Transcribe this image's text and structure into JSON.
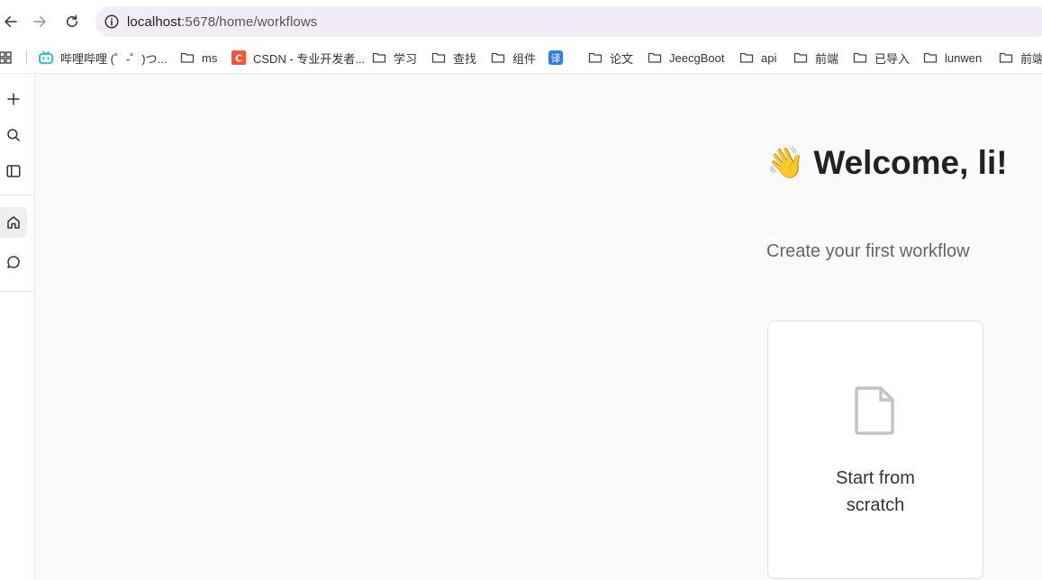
{
  "browser": {
    "url_host": "localhost",
    "url_rest": ":5678/home/workflows"
  },
  "bookmarks": [
    {
      "label": "哔哩哔哩 (゜-゜)つ...",
      "icon": "bilibili-icon"
    },
    {
      "label": "ms",
      "icon": "folder-icon"
    },
    {
      "label": "CSDN - 专业开发者...",
      "icon": "csdn-icon"
    },
    {
      "label": "学习",
      "icon": "folder-icon"
    },
    {
      "label": "查找",
      "icon": "folder-icon"
    },
    {
      "label": "组件",
      "icon": "folder-icon"
    },
    {
      "label": "",
      "icon": "translate-icon"
    },
    {
      "label": "论文",
      "icon": "folder-icon"
    },
    {
      "label": "JeecgBoot",
      "icon": "folder-icon"
    },
    {
      "label": "api",
      "icon": "folder-icon"
    },
    {
      "label": "前端",
      "icon": "folder-icon"
    },
    {
      "label": "已导入",
      "icon": "folder-icon"
    },
    {
      "label": "lunwen",
      "icon": "folder-icon"
    },
    {
      "label": "前端",
      "icon": "folder-icon"
    }
  ],
  "sidebar": {
    "icons": [
      "plus-icon",
      "search-icon",
      "sidebar-toggle-icon",
      "home-icon",
      "chat-icon"
    ]
  },
  "main": {
    "wave_emoji": "👋",
    "welcome": "Welcome, li!",
    "subtitle": "Create your first workflow",
    "card_line1": "Start from",
    "card_line2": "scratch"
  },
  "colors": {
    "background": "#fafafa",
    "address_bar": "#f1ecf6",
    "csdn": "#fc5531",
    "bilibili": "#00aeec",
    "translate": "#2b7ef0"
  }
}
